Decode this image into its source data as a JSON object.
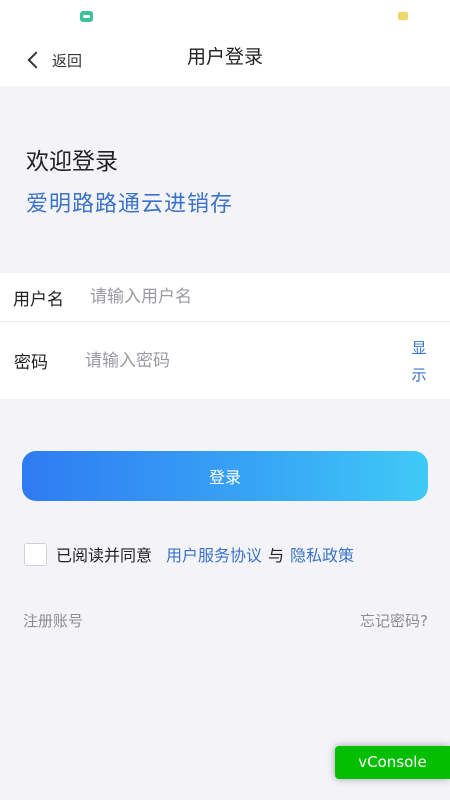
{
  "nav": {
    "back_label": "返回",
    "title": "用户登录"
  },
  "intro": {
    "welcome": "欢迎登录",
    "app_name": "爱明路路通云进销存"
  },
  "form": {
    "username": {
      "label": "用户名",
      "placeholder": "请输入用户名",
      "value": ""
    },
    "password": {
      "label": "密码",
      "placeholder": "请输入密码",
      "value": "",
      "toggle_label": "显示"
    }
  },
  "login_button": "登录",
  "agreement": {
    "checked": false,
    "text": "已阅读并同意",
    "service_link": "用户服务协议",
    "separator": "与",
    "privacy_link": "隐私政策"
  },
  "footer": {
    "register": "注册账号",
    "forgot": "忘记密码?"
  },
  "vconsole_label": "vConsole",
  "colors": {
    "accent": "#3a73c8",
    "button_gradient_start": "#2f7bf2",
    "button_gradient_end": "#3fcaf6",
    "vconsole": "#04be02"
  },
  "icons": {
    "status_left": "chat-bubble-icon",
    "status_right": "battery-icon",
    "back": "chevron-left-icon"
  }
}
